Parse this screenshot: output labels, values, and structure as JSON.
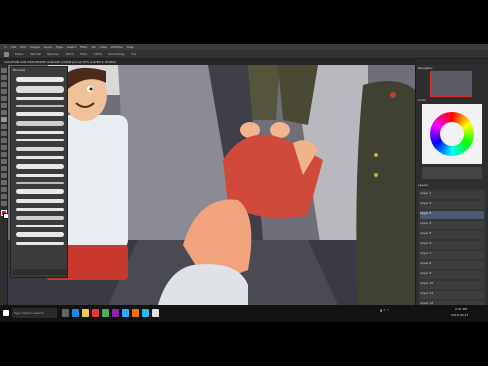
{
  "menu": [
    "Ps",
    "File",
    "Edit",
    "Image",
    "Layer",
    "Type",
    "Select",
    "Filter",
    "3D",
    "View",
    "Window",
    "Help"
  ],
  "options": [
    "Mode:",
    "Normal",
    "Opacity:",
    "100%",
    "Flow:",
    "100%",
    "Smoothing:",
    "0%"
  ],
  "document_tab": "LOCATION CAR DEALERSHIP GARAGE (CAR)B.psd @ 50% (LAYER 2, RGB/8)",
  "brushes_panel": {
    "title": "Brushes"
  },
  "navigator_panel": {
    "title": "Navigator"
  },
  "color_panel": {
    "title": "Color"
  },
  "layers_panel": {
    "title": "Layers",
    "items": [
      "Layer 1",
      "Layer 2",
      "Layer 3",
      "Layer 4",
      "Layer 5",
      "Layer 6",
      "Layer 7",
      "Layer 8",
      "Layer 9",
      "Layer 10",
      "Layer 11",
      "Layer 12"
    ]
  },
  "status": {
    "zoom": "50%",
    "doc": "Doc: 24.7M/81.3M"
  },
  "taskbar": {
    "search_placeholder": "Type here to search",
    "time": "2:51 PM",
    "date": "2018-09-27"
  }
}
